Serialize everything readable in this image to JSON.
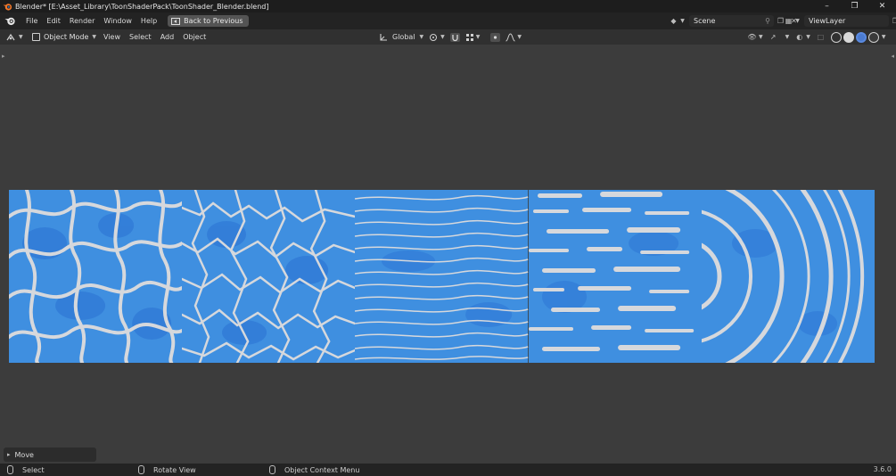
{
  "window": {
    "title": "Blender* [E:\\Asset_Library\\ToonShaderPack\\ToonShader_Blender.blend]",
    "controls": [
      "minimize-icon",
      "restore-icon",
      "close-icon"
    ]
  },
  "menubar": {
    "items": [
      "File",
      "Edit",
      "Render",
      "Window",
      "Help"
    ],
    "back_label": "Back to Previous",
    "scene_name": "Scene",
    "view_layer": "ViewLayer"
  },
  "viewport_header": {
    "mode": "Object Mode",
    "menus": [
      "View",
      "Select",
      "Add",
      "Object"
    ],
    "transform_orientation": "Global"
  },
  "viewport": {
    "background_color": "#3c3c3c",
    "water_color": "#3f8fe0",
    "foam_color": "#d6d8dc",
    "tiles": [
      "caustic-web",
      "caustic-cracked",
      "wavy-lines",
      "streak-foam",
      "ripple-rings"
    ]
  },
  "last_operator": {
    "label": "Move"
  },
  "statusbar": {
    "select": "Select",
    "rotate": "Rotate View",
    "context": "Object Context Menu",
    "version": "3.6.0"
  }
}
